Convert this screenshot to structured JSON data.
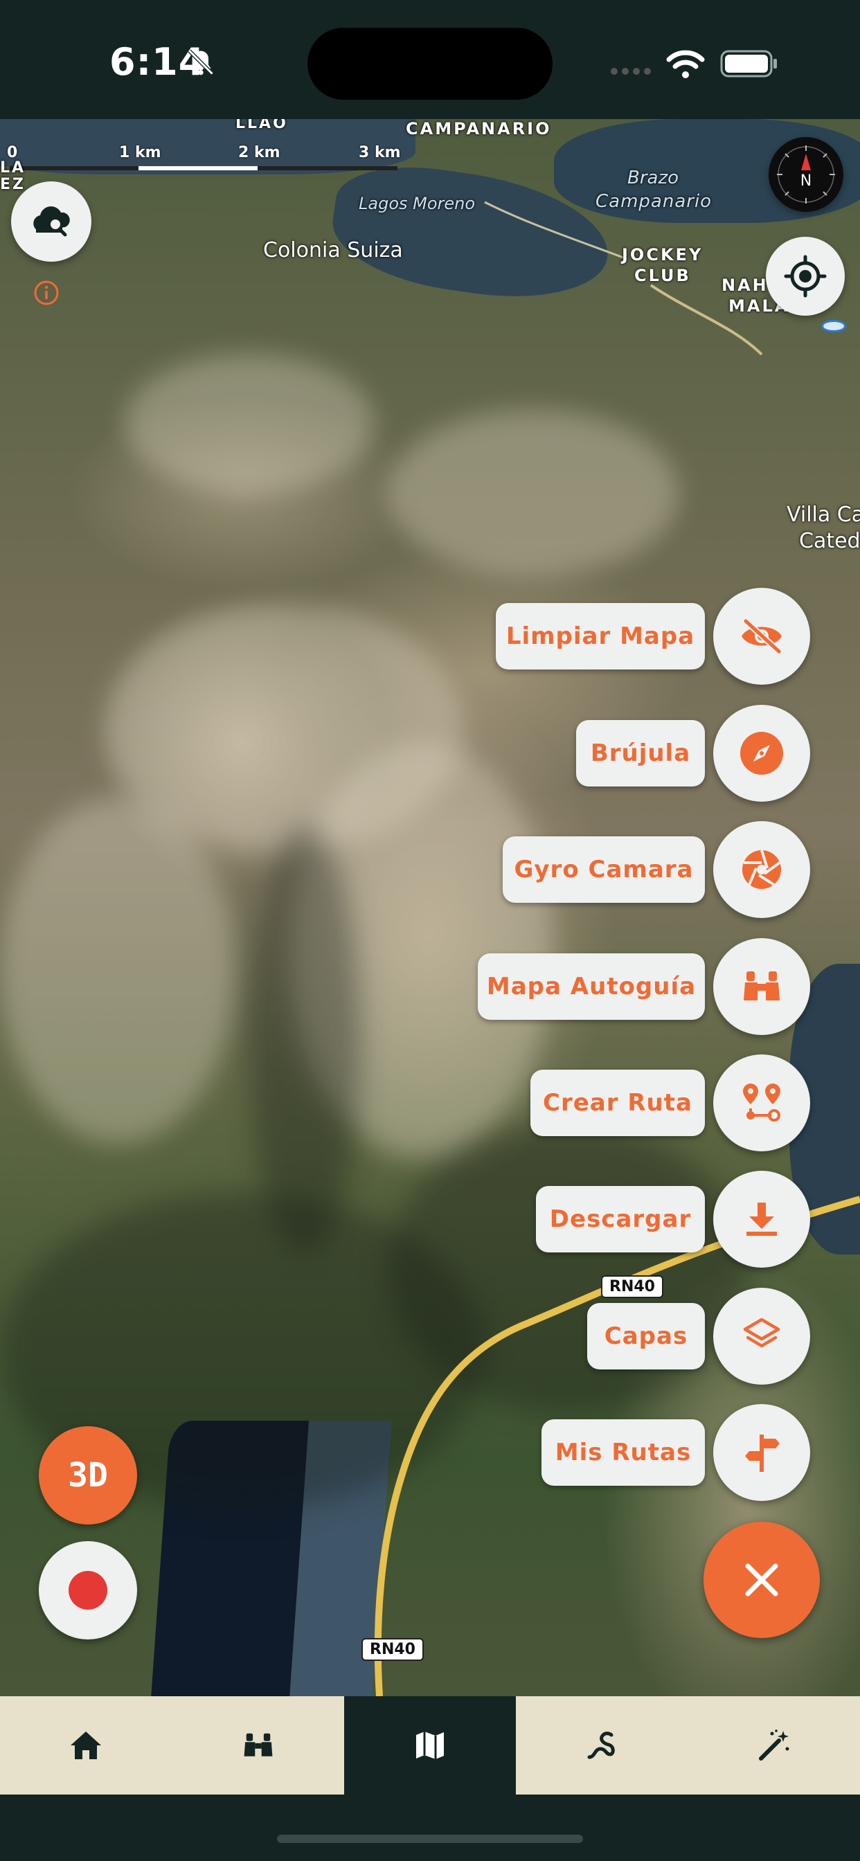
{
  "status_bar": {
    "time": "6:14",
    "icons": [
      "bell-slash-icon",
      "cellular-signal-icon",
      "wifi-icon",
      "battery-icon"
    ]
  },
  "map": {
    "scale": {
      "labels": [
        "0",
        "1 km",
        "2 km",
        "3 km"
      ]
    },
    "places": {
      "campanario": "CAMPANARIO",
      "llao": "LLAO",
      "brazo": "Brazo",
      "campanario_italic": "Campanario",
      "lagos_moreno": "Lagos Moreno",
      "colonia_suiza": "Colonia Suiza",
      "jockey": "JOCKEY",
      "club": "CLUB",
      "nah": "NAH",
      "mala": "MALA",
      "villa_ca": "Villa Ca",
      "cated": "Cated",
      "edge_la": "LA",
      "edge_ez": "EZ"
    },
    "road_labels": [
      "RN40",
      "RN40"
    ],
    "compass_letter": "N"
  },
  "actions": [
    {
      "label": "Limpiar Mapa",
      "icon": "eye-slash-icon"
    },
    {
      "label": "Brújula",
      "icon": "compass-icon"
    },
    {
      "label": "Gyro Camara",
      "icon": "aperture-icon"
    },
    {
      "label": "Mapa Autoguía",
      "icon": "binoculars-icon"
    },
    {
      "label": "Crear Ruta",
      "icon": "route-pins-icon"
    },
    {
      "label": "Descargar",
      "icon": "download-icon"
    },
    {
      "label": "Capas",
      "icon": "layers-icon"
    },
    {
      "label": "Mis Rutas",
      "icon": "signpost-icon"
    }
  ],
  "left_controls": {
    "mode_label": "3D"
  },
  "tabbar": {
    "tabs": [
      {
        "icon": "home-icon",
        "active": false
      },
      {
        "icon": "binoculars-icon",
        "active": false
      },
      {
        "icon": "map-icon",
        "active": true
      },
      {
        "icon": "trail-icon",
        "active": false
      },
      {
        "icon": "magic-wand-icon",
        "active": false
      }
    ]
  },
  "colors": {
    "accent": "#ef6b35",
    "dark": "#142423",
    "tabbar_bg": "#e7e1cb",
    "button_bg": "#eef1f0",
    "record": "#e53935"
  }
}
